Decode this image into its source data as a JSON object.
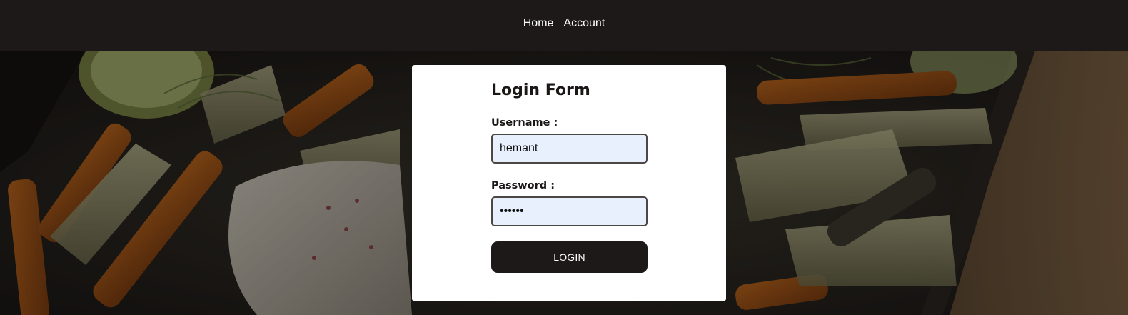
{
  "nav": {
    "items": [
      {
        "label": "Home"
      },
      {
        "label": "Account"
      }
    ]
  },
  "login_form": {
    "title": "Login Form",
    "username_label": "Username :",
    "username_value": "hemant",
    "password_label": "Password :",
    "password_value": "hemant",
    "login_button": "LOGIN"
  },
  "colors": {
    "navbar_bg": "#1c1918",
    "card_bg": "#ffffff",
    "input_bg": "#e8f0fe",
    "button_bg": "#1c1918",
    "button_text": "#ffffff"
  },
  "background_image": "roasted-vegetables-and-fish-photo"
}
